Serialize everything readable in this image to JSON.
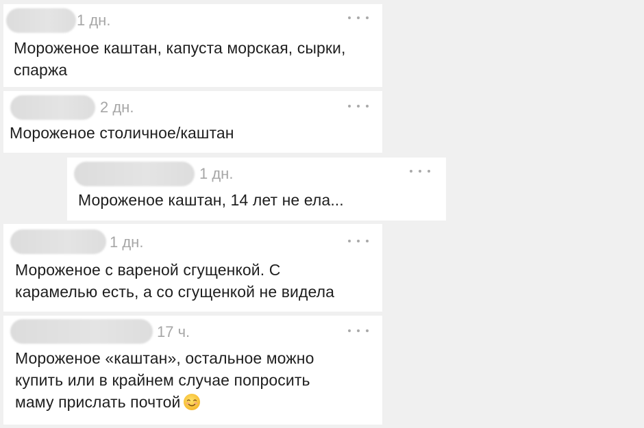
{
  "comments": [
    {
      "time": "1 дн.",
      "lines": [
        "Мороженое каштан, капуста морская, сырки,",
        "спаржа"
      ]
    },
    {
      "time": "2 дн.",
      "lines": [
        "Мороженое столичное/каштан"
      ]
    },
    {
      "time": "1 дн.",
      "lines": [
        "Мороженое каштан, 14 лет не ела..."
      ]
    },
    {
      "time": "1 дн.",
      "lines": [
        "Мороженое с вареной сгущенкой. С",
        "карамелью есть, а со сгущенкой не видела"
      ]
    },
    {
      "time": "17 ч.",
      "lines": [
        "Мороженое «каштан», остальное можно",
        "купить или в крайнем случае попросить",
        "маму прислать почтой"
      ],
      "emoji": "smiling-face-emoji"
    }
  ],
  "more_icon": "more-horizontal-icon",
  "colors": {
    "page_background": "#f0f0f0",
    "card_background": "#ffffff",
    "meta_text": "#a6a6a6",
    "body_text": "#1e1e1e"
  }
}
